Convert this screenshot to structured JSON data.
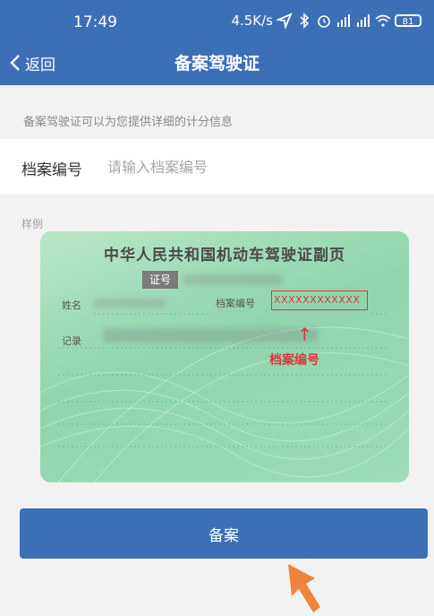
{
  "status_bar": {
    "time": "17:49",
    "speed": "4.5K/s",
    "battery": "81",
    "icons": [
      "navigation-icon",
      "bluetooth-icon",
      "alarm-icon",
      "hd-signal-icon",
      "hd-signal-icon",
      "wifi-icon",
      "battery-icon"
    ]
  },
  "nav": {
    "back_label": "返回",
    "title": "备案驾驶证"
  },
  "form": {
    "description": "备案驾驶证可以为您提供详细的计分信息",
    "file_number_label": "档案编号",
    "file_number_placeholder": "请输入档案编号",
    "file_number_value": ""
  },
  "sample": {
    "label": "样例",
    "card_title": "中华人民共和国机动车驾驶证副页",
    "cert_badge": "证号",
    "name_label": "姓名",
    "file_label": "档案编号",
    "file_number": "XXXXXXXXXXXX",
    "record_label": "记录",
    "annotation": "档案编号"
  },
  "submit_label": "备案",
  "colors": {
    "primary": "#3c6fb6",
    "background": "#f2f2f3",
    "annotation_red": "#d63a3a",
    "card_green": "#9edcba",
    "pointer_orange": "#f0843c"
  }
}
